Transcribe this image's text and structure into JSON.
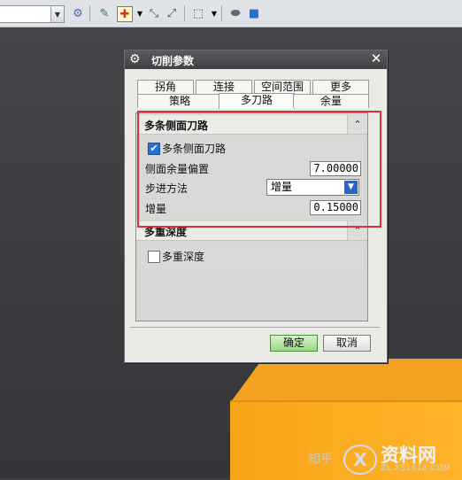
{
  "dialog": {
    "title": "切削参数",
    "tabs_row1": [
      "拐角",
      "连接",
      "空间范围",
      "更多"
    ],
    "tabs_row2": [
      "策略",
      "多刀路",
      "余量"
    ],
    "active_tab": "多刀路"
  },
  "multipath_section": {
    "header": "多条侧面刀路",
    "checkbox_label": "多条侧面刀路",
    "checkbox_checked": true,
    "offset_label": "侧面余量偏置",
    "offset_value": "7.00000",
    "step_label": "步进方法",
    "step_value": "增量",
    "increment_label": "增量",
    "increment_value": "0.15000"
  },
  "depth_section": {
    "header": "多重深度",
    "checkbox_label": "多重深度",
    "checkbox_checked": false
  },
  "buttons": {
    "ok": "确定",
    "cancel": "取消"
  },
  "watermark": {
    "zhihu": "知乎",
    "brand": "资料网",
    "url": "ZL.XS1616.COM",
    "logo_letter": "X"
  },
  "colors": {
    "highlight_box": "#e0303a",
    "block": "#f7a417",
    "ok_button": "#9ad98a"
  }
}
